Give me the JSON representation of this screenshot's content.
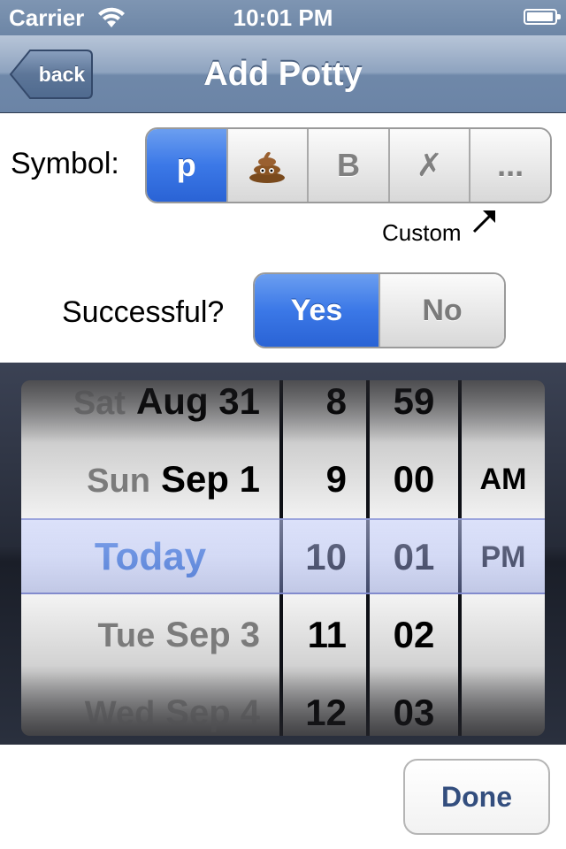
{
  "status_bar": {
    "carrier": "Carrier",
    "time": "10:01 PM"
  },
  "nav": {
    "back_label": "back",
    "title": "Add Potty"
  },
  "symbol": {
    "label": "Symbol:",
    "options": [
      "p",
      "poo-emoji",
      "B",
      "✗",
      "..."
    ],
    "selected_index": 0,
    "custom_hint": "Custom"
  },
  "successful": {
    "label": "Successful?",
    "options": [
      "Yes",
      "No"
    ],
    "selected_index": 0
  },
  "picker": {
    "dates": [
      {
        "dow": "Sat",
        "date": "Aug 31"
      },
      {
        "dow": "Sun",
        "date": "Sep 1"
      },
      {
        "dow": "",
        "date": "Today"
      },
      {
        "dow": "Tue",
        "date": "Sep 3"
      },
      {
        "dow": "Wed",
        "date": "Sep 4"
      }
    ],
    "hours": [
      "8",
      "9",
      "10",
      "11",
      "12"
    ],
    "minutes": [
      "59",
      "00",
      "01",
      "02",
      "03"
    ],
    "ampm": [
      "AM",
      "PM"
    ],
    "selected": {
      "date": "Today",
      "hour": "10",
      "minute": "01",
      "ampm": "PM"
    }
  },
  "done_label": "Done",
  "colors": {
    "accent": "#3b78e7",
    "nav": "#6f88a9",
    "today": "#2f6fd6"
  }
}
